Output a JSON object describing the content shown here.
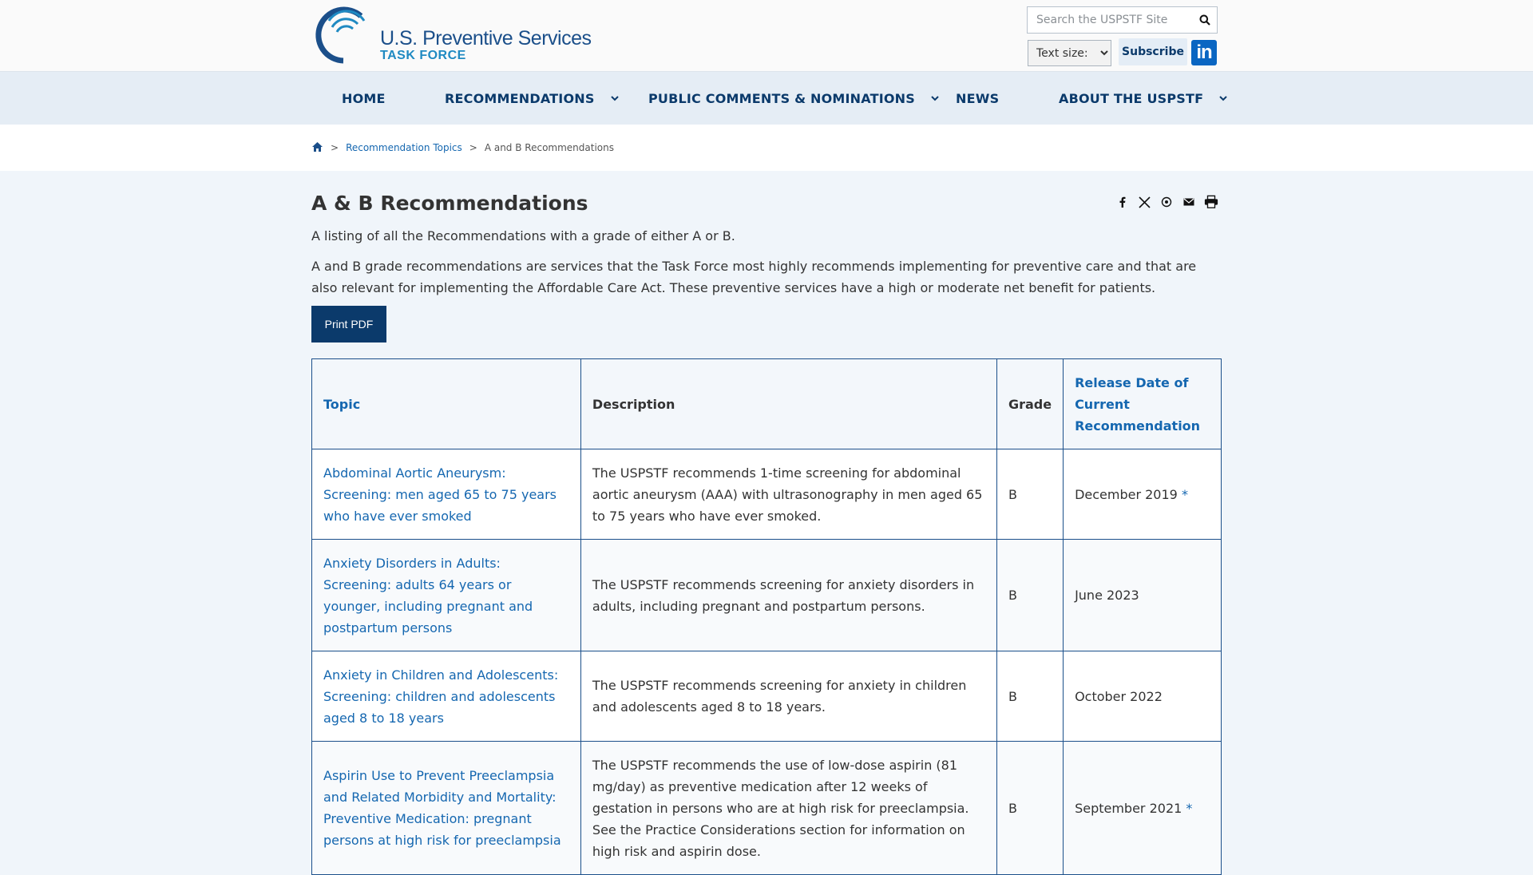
{
  "header": {
    "logo": {
      "line1": "U.S. Preventive Services",
      "line2": "TASK FORCE"
    },
    "search": {
      "placeholder": "Search the USPSTF Site"
    },
    "text_size_label": "Text size:",
    "subscribe_label": "Subscribe",
    "linkedin_label": "in"
  },
  "nav": {
    "items": [
      {
        "label": "HOME",
        "has_menu": false
      },
      {
        "label": "RECOMMENDATIONS",
        "has_menu": true
      },
      {
        "label": "PUBLIC COMMENTS & NOMINATIONS",
        "has_menu": true
      },
      {
        "label": "NEWS",
        "has_menu": false
      },
      {
        "label": "ABOUT THE USPSTF",
        "has_menu": true
      }
    ],
    "caret": "⌄"
  },
  "breadcrumb": {
    "separator": ">",
    "items": [
      "Recommendation Topics",
      "A and B Recommendations"
    ]
  },
  "page": {
    "title": "A & B Recommendations",
    "intro1": "A listing of all the Recommendations with a grade of either A or B.",
    "intro2": "A and B grade recommendations are services that the Task Force most highly recommends implementing for preventive care and that are also relevant for implementing the Affordable Care Act. These preventive services have a high or moderate net benefit for patients.",
    "print_pdf_label": "Print PDF",
    "share_icons": [
      "facebook-icon",
      "x-icon",
      "whatsapp-icon",
      "email-icon",
      "print-icon"
    ]
  },
  "table": {
    "headers": {
      "topic": "Topic",
      "description": "Description",
      "grade": "Grade",
      "release": "Release Date of Current Recommendation"
    },
    "rows": [
      {
        "topic": "Abdominal Aortic Aneurysm: Screening: men aged 65 to 75 years who have ever smoked",
        "description": "The USPSTF recommends 1-time screening for abdominal aortic aneurysm (AAA) with ultrasonography in men aged 65 to 75 years who have ever smoked.",
        "grade": "B",
        "date": "December 2019",
        "asterisk": "*"
      },
      {
        "topic": "Anxiety Disorders in Adults: Screening: adults 64 years or younger, including pregnant and postpartum persons",
        "description": "The USPSTF recommends screening for anxiety disorders in adults, including pregnant and postpartum persons.",
        "grade": "B",
        "date": "June 2023",
        "asterisk": ""
      },
      {
        "topic": "Anxiety in Children and Adolescents: Screening: children and adolescents aged 8 to 18 years",
        "description": "The USPSTF recommends screening for anxiety in children and adolescents aged 8 to 18 years.",
        "grade": "B",
        "date": "October 2022",
        "asterisk": ""
      },
      {
        "topic": "Aspirin Use to Prevent Preeclampsia and Related Morbidity and Mortality: Preventive Medication: pregnant persons at high risk for preeclampsia",
        "description": "The USPSTF recommends the use of low-dose aspirin (81 mg/day) as preventive medication after 12 weeks of gestation in persons who are at high risk for preeclampsia. See the Practice Considerations section for information on high risk and aspirin dose.",
        "grade": "B",
        "date": "September 2021",
        "asterisk": "*"
      }
    ]
  },
  "colors": {
    "navy": "#0b3a6b",
    "link": "#1567b0",
    "nav_bg": "#e5edf5",
    "page_bg": "#f0f5fa"
  }
}
